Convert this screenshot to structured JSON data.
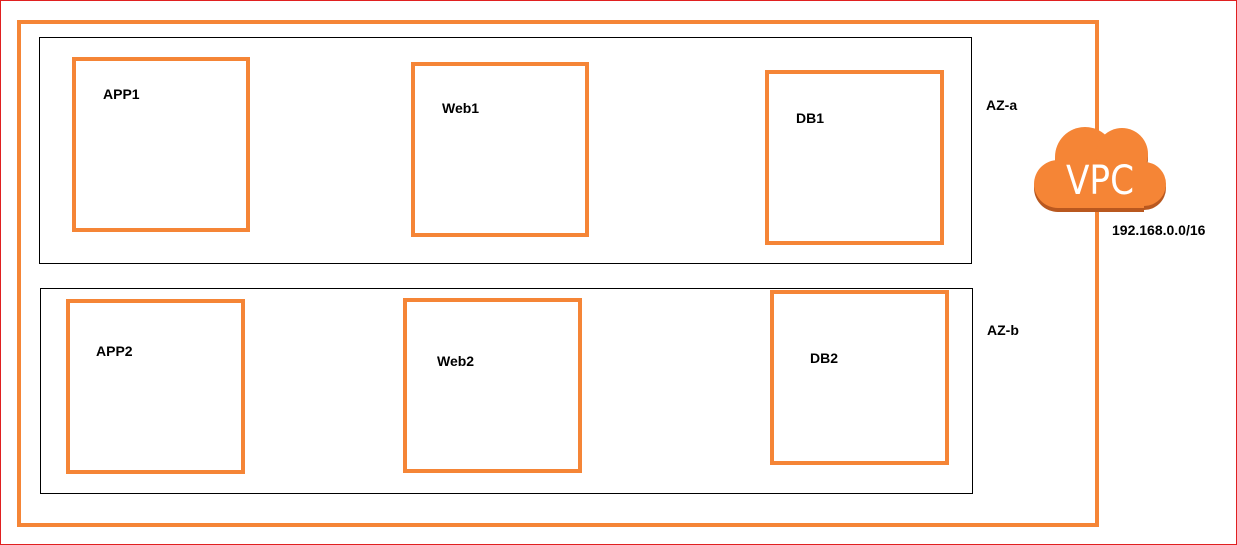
{
  "vpc": {
    "label": "VPC",
    "cidr": "192.168.0.0/16"
  },
  "zones": [
    {
      "label": "AZ-a",
      "servers": [
        "APP1",
        "Web1",
        "DB1"
      ]
    },
    {
      "label": "AZ-b",
      "servers": [
        "APP2",
        "Web2",
        "DB2"
      ]
    }
  ],
  "colors": {
    "accent": "#f58536",
    "frame": "#e02020",
    "zone_border": "#000000"
  }
}
